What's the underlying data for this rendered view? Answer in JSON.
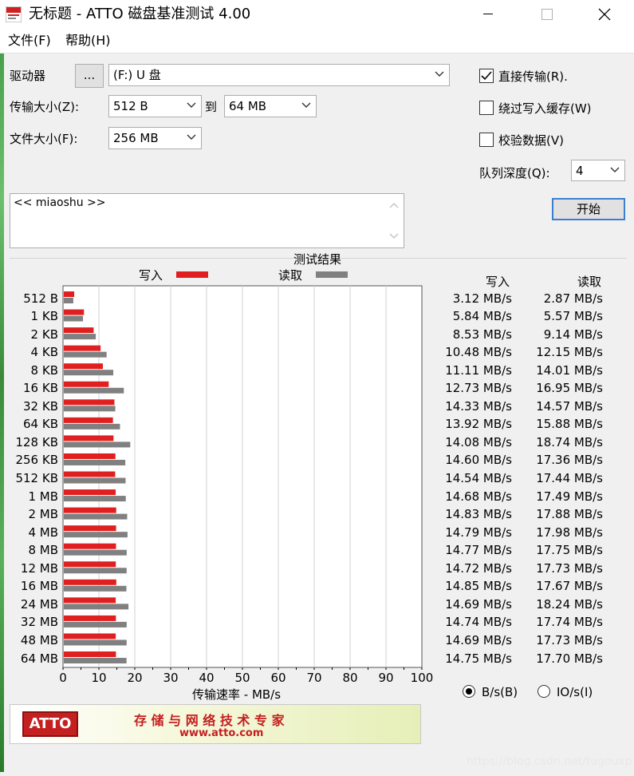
{
  "window": {
    "title": "无标题 - ATTO 磁盘基准测试 4.00",
    "icon": "atto-app-icon"
  },
  "menu": [
    "文件(F)",
    "帮助(H)"
  ],
  "controls": {
    "drive_label": "驱动器",
    "browse_button": "...",
    "drive_value": "(F:) U 盘",
    "transfer_size_label": "传输大小(Z):",
    "transfer_from": "512 B",
    "to_label": "到",
    "transfer_to": "64 MB",
    "file_size_label": "文件大小(F):",
    "file_size": "256 MB",
    "direct_io_label": "直接传输(R).",
    "direct_io_checked": true,
    "bypass_cache_label": "绕过写入缓存(W)",
    "bypass_cache_checked": false,
    "verify_label": "校验数据(V)",
    "verify_checked": false,
    "queue_depth_label": "队列深度(Q):",
    "queue_depth": "4",
    "start_button": "开始",
    "description": "<< miaoshu >>"
  },
  "results": {
    "title": "测试结果",
    "legend_write": "写入",
    "legend_read": "读取",
    "write_header": "写入",
    "read_header": "读取",
    "write_color": "#e02020",
    "read_color": "#808080",
    "xlabel": "传输速率 - MB/s",
    "write_values_text": [
      "3.12 MB/s",
      "5.84 MB/s",
      "8.53 MB/s",
      "10.48 MB/s",
      "11.11 MB/s",
      "12.73 MB/s",
      "14.33 MB/s",
      "13.92 MB/s",
      "14.08 MB/s",
      "14.60 MB/s",
      "14.54 MB/s",
      "14.68 MB/s",
      "14.83 MB/s",
      "14.79 MB/s",
      "14.77 MB/s",
      "14.72 MB/s",
      "14.85 MB/s",
      "14.69 MB/s",
      "14.74 MB/s",
      "14.69 MB/s",
      "14.75 MB/s"
    ],
    "read_values_text": [
      "2.87 MB/s",
      "5.57 MB/s",
      "9.14 MB/s",
      "12.15 MB/s",
      "14.01 MB/s",
      "16.95 MB/s",
      "14.57 MB/s",
      "15.88 MB/s",
      "18.74 MB/s",
      "17.36 MB/s",
      "17.44 MB/s",
      "17.49 MB/s",
      "17.88 MB/s",
      "17.98 MB/s",
      "17.75 MB/s",
      "17.73 MB/s",
      "17.67 MB/s",
      "18.24 MB/s",
      "17.74 MB/s",
      "17.73 MB/s",
      "17.70 MB/s"
    ],
    "unit_bytes_label": "B/s(B)",
    "unit_io_label": "IO/s(I)",
    "unit_selected": "B/s"
  },
  "chart_data": {
    "type": "bar",
    "orientation": "horizontal",
    "categories": [
      "512 B",
      "1 KB",
      "2 KB",
      "4 KB",
      "8 KB",
      "16 KB",
      "32 KB",
      "64 KB",
      "128 KB",
      "256 KB",
      "512 KB",
      "1 MB",
      "2 MB",
      "4 MB",
      "8 MB",
      "12 MB",
      "16 MB",
      "24 MB",
      "32 MB",
      "48 MB",
      "64 MB"
    ],
    "series": [
      {
        "name": "写入",
        "values": [
          3.12,
          5.84,
          8.53,
          10.48,
          11.11,
          12.73,
          14.33,
          13.92,
          14.08,
          14.6,
          14.54,
          14.68,
          14.83,
          14.79,
          14.77,
          14.72,
          14.85,
          14.69,
          14.74,
          14.69,
          14.75
        ]
      },
      {
        "name": "读取",
        "values": [
          2.87,
          5.57,
          9.14,
          12.15,
          14.01,
          16.95,
          14.57,
          15.88,
          18.74,
          17.36,
          17.44,
          17.49,
          17.88,
          17.98,
          17.75,
          17.73,
          17.67,
          18.24,
          17.74,
          17.73,
          17.7
        ]
      }
    ],
    "xlim": [
      0,
      100
    ],
    "xticks": [
      "0",
      "10",
      "20",
      "30",
      "40",
      "50",
      "60",
      "70",
      "80",
      "90",
      "100"
    ],
    "xlabel": "传输速率 - MB/s",
    "title": "测试结果",
    "grid": true
  },
  "banner": {
    "logo": "ATTO",
    "tagline": "存 储 与 网 络 技 术 专 家",
    "url": "www.atto.com"
  },
  "watermark": "https://blog.csdn.net/tugouxp"
}
